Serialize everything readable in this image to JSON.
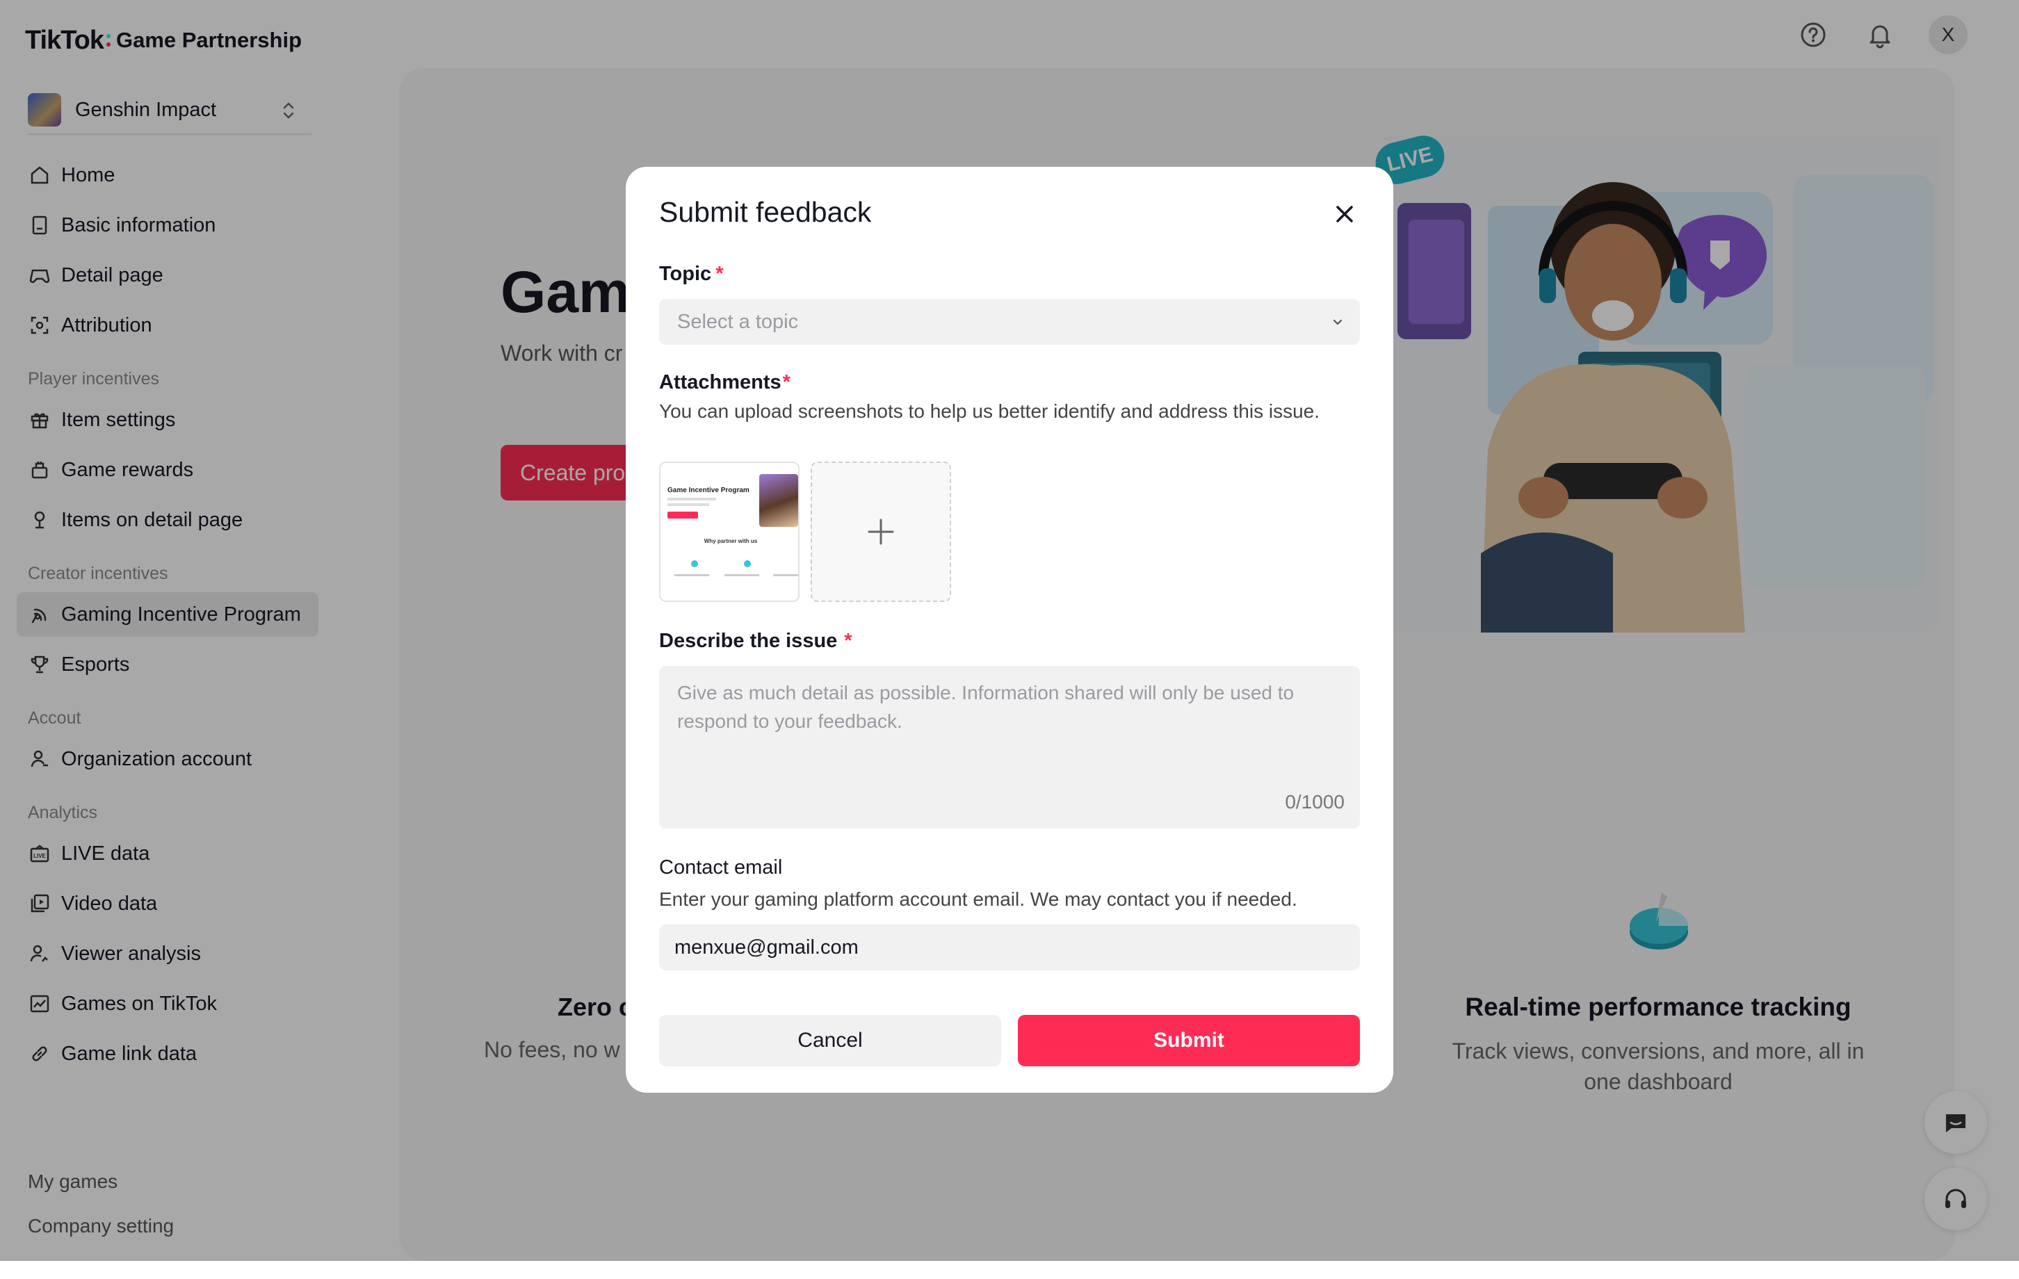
{
  "app": {
    "brand": "TikTok",
    "product": "Game Partnership",
    "user_initial": "X"
  },
  "colors": {
    "accent": "#fe2c55",
    "colon_cyan": "#25f4ee",
    "colon_red": "#fe2c55"
  },
  "game_selector": {
    "name": "Genshin Impact"
  },
  "sidebar": {
    "items": [
      {
        "label": "Home",
        "icon": "home-icon"
      },
      {
        "label": "Basic information",
        "icon": "document-icon"
      },
      {
        "label": "Detail page",
        "icon": "gamepad-icon"
      },
      {
        "label": "Attribution",
        "icon": "scan-icon"
      }
    ],
    "player_incentives": {
      "title": "Player incentives",
      "items": [
        {
          "label": "Item settings",
          "icon": "gift-icon"
        },
        {
          "label": "Game rewards",
          "icon": "reward-icon"
        },
        {
          "label": "Items on detail page",
          "icon": "medal-icon"
        }
      ]
    },
    "creator_incentives": {
      "title": "Creator incentives",
      "items": [
        {
          "label": "Gaming Incentive Program",
          "icon": "broadcast-icon"
        },
        {
          "label": "Esports",
          "icon": "trophy-icon"
        }
      ]
    },
    "account": {
      "title": "Accout",
      "items": [
        {
          "label": "Organization account",
          "icon": "user-icon"
        }
      ]
    },
    "analytics": {
      "title": "Analytics",
      "items": [
        {
          "label": "LIVE data",
          "icon": "live-icon"
        },
        {
          "label": "Video data",
          "icon": "video-icon"
        },
        {
          "label": "Viewer analysis",
          "icon": "user-chart-icon"
        },
        {
          "label": "Games on TikTok",
          "icon": "line-chart-icon"
        },
        {
          "label": "Game link data",
          "icon": "link-icon"
        }
      ]
    },
    "footer": {
      "my_games": "My games",
      "company_setting": "Company setting"
    }
  },
  "background": {
    "hero_title": "Gam",
    "hero_subtitle": "Work with cr players throu",
    "hero_button": "Create pro",
    "live_badge": "LIVE",
    "feature_left_title": "Zero c",
    "feature_left_sub": "No fees, no w",
    "feature_right_title": "Real-time performance tracking",
    "feature_right_sub": "Track views, conversions, and more, all in one dashboard"
  },
  "modal": {
    "title": "Submit feedback",
    "topic_label": "Topic",
    "required_mark": "*",
    "topic_placeholder": "Select a topic",
    "attachments_label": "Attachments",
    "attachments_help": "You can upload screenshots to help us better identify and address this issue.",
    "thumbnail": {
      "title": "Game Incentive Program",
      "section": "Why partner with us"
    },
    "describe_label": "Describe the issue",
    "describe_placeholder": "Give as much detail as possible. Information shared will only be used to respond to your feedback.",
    "char_count": "0/1000",
    "email_label": "Contact email",
    "email_help": "Enter your gaming platform account email. We may contact you if needed.",
    "email_value": "menxue@gmail.com",
    "cancel": "Cancel",
    "submit": "Submit"
  }
}
